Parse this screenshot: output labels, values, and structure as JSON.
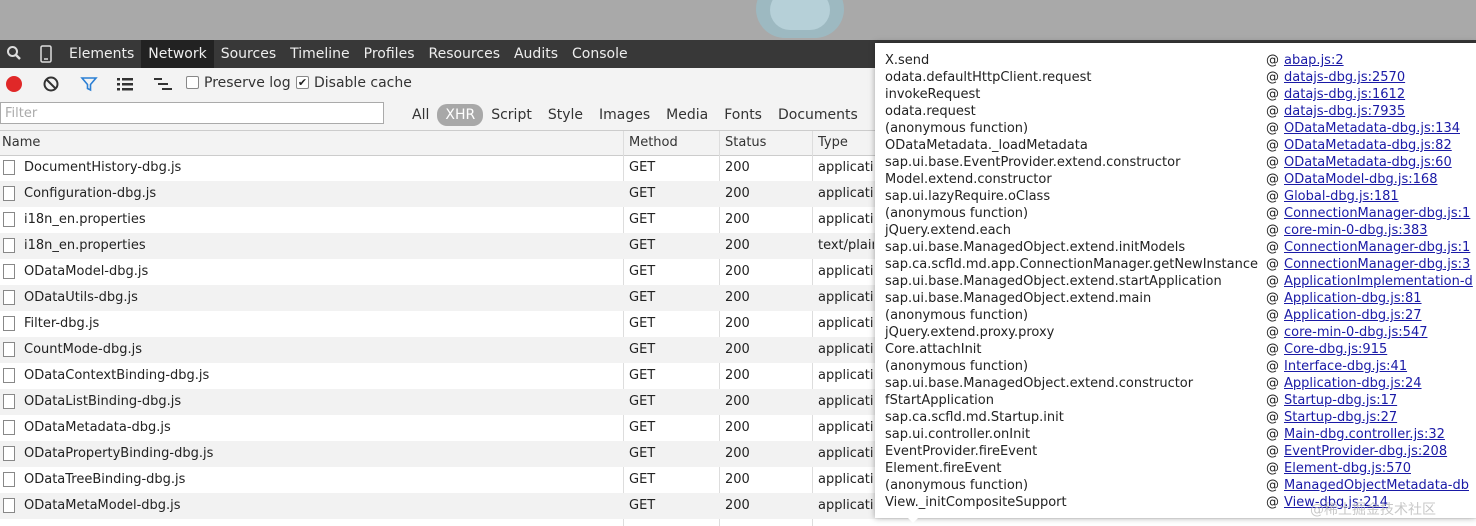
{
  "devtools": {
    "tabs": [
      "Elements",
      "Network",
      "Sources",
      "Timeline",
      "Profiles",
      "Resources",
      "Audits",
      "Console"
    ],
    "active_tab": "Network",
    "icons": {
      "search": "search-icon",
      "device": "mobile-device-icon"
    }
  },
  "toolbar": {
    "record_color": "#e02828",
    "preserve_log": "Preserve log",
    "preserve_log_checked": false,
    "disable_cache": "Disable cache",
    "disable_cache_checked": true
  },
  "filter": {
    "placeholder": "Filter",
    "types": [
      "All",
      "XHR",
      "Script",
      "Style",
      "Images",
      "Media",
      "Fonts",
      "Documents"
    ],
    "active_type": "XHR"
  },
  "table": {
    "headers": {
      "name": "Name",
      "method": "Method",
      "status": "Status",
      "type": "Type"
    },
    "rows": [
      {
        "name": "DocumentHistory-dbg.js",
        "method": "GET",
        "status": "200",
        "type": "applicatio"
      },
      {
        "name": "Configuration-dbg.js",
        "method": "GET",
        "status": "200",
        "type": "applicatio"
      },
      {
        "name": "i18n_en.properties",
        "method": "GET",
        "status": "200",
        "type": "applicatio"
      },
      {
        "name": "i18n_en.properties",
        "method": "GET",
        "status": "200",
        "type": "text/plain"
      },
      {
        "name": "ODataModel-dbg.js",
        "method": "GET",
        "status": "200",
        "type": "applicatio"
      },
      {
        "name": "ODataUtils-dbg.js",
        "method": "GET",
        "status": "200",
        "type": "applicatio"
      },
      {
        "name": "Filter-dbg.js",
        "method": "GET",
        "status": "200",
        "type": "applicatio"
      },
      {
        "name": "CountMode-dbg.js",
        "method": "GET",
        "status": "200",
        "type": "applicatio"
      },
      {
        "name": "ODataContextBinding-dbg.js",
        "method": "GET",
        "status": "200",
        "type": "applicatio"
      },
      {
        "name": "ODataListBinding-dbg.js",
        "method": "GET",
        "status": "200",
        "type": "applicatio"
      },
      {
        "name": "ODataMetadata-dbg.js",
        "method": "GET",
        "status": "200",
        "type": "applicatio"
      },
      {
        "name": "ODataPropertyBinding-dbg.js",
        "method": "GET",
        "status": "200",
        "type": "applicatio"
      },
      {
        "name": "ODataTreeBinding-dbg.js",
        "method": "GET",
        "status": "200",
        "type": "applicatio"
      },
      {
        "name": "ODataMetaModel-dbg.js",
        "method": "GET",
        "status": "200",
        "type": "applicatio"
      }
    ]
  },
  "callstack": {
    "at_symbol": "@",
    "frames": [
      {
        "fn": "X.send",
        "link": "abap.js:2"
      },
      {
        "fn": "odata.defaultHttpClient.request",
        "link": "datajs-dbg.js:2570"
      },
      {
        "fn": "invokeRequest",
        "link": "datajs-dbg.js:1612"
      },
      {
        "fn": "odata.request",
        "link": "datajs-dbg.js:7935"
      },
      {
        "fn": "(anonymous function)",
        "link": "ODataMetadata-dbg.js:134"
      },
      {
        "fn": "ODataMetadata._loadMetadata",
        "link": "ODataMetadata-dbg.js:82"
      },
      {
        "fn": "sap.ui.base.EventProvider.extend.constructor",
        "link": "ODataMetadata-dbg.js:60"
      },
      {
        "fn": "Model.extend.constructor",
        "link": "ODataModel-dbg.js:168"
      },
      {
        "fn": "sap.ui.lazyRequire.oClass",
        "link": "Global-dbg.js:181"
      },
      {
        "fn": "(anonymous function)",
        "link": "ConnectionManager-dbg.js:1"
      },
      {
        "fn": "jQuery.extend.each",
        "link": "core-min-0-dbg.js:383"
      },
      {
        "fn": "sap.ui.base.ManagedObject.extend.initModels",
        "link": "ConnectionManager-dbg.js:1"
      },
      {
        "fn": "sap.ca.scfld.md.app.ConnectionManager.getNewInstance",
        "link": "ConnectionManager-dbg.js:3"
      },
      {
        "fn": "sap.ui.base.ManagedObject.extend.startApplication",
        "link": "ApplicationImplementation-d"
      },
      {
        "fn": "sap.ui.base.ManagedObject.extend.main",
        "link": "Application-dbg.js:81"
      },
      {
        "fn": "(anonymous function)",
        "link": "Application-dbg.js:27"
      },
      {
        "fn": "jQuery.extend.proxy.proxy",
        "link": "core-min-0-dbg.js:547"
      },
      {
        "fn": "Core.attachInit",
        "link": "Core-dbg.js:915"
      },
      {
        "fn": "(anonymous function)",
        "link": "Interface-dbg.js:41"
      },
      {
        "fn": "sap.ui.base.ManagedObject.extend.constructor",
        "link": "Application-dbg.js:24"
      },
      {
        "fn": "fStartApplication",
        "link": "Startup-dbg.js:17"
      },
      {
        "fn": "sap.ca.scfld.md.Startup.init",
        "link": "Startup-dbg.js:27"
      },
      {
        "fn": "sap.ui.controller.onInit",
        "link": "Main-dbg.controller.js:32"
      },
      {
        "fn": "EventProvider.fireEvent",
        "link": "EventProvider-dbg.js:208"
      },
      {
        "fn": "Element.fireEvent",
        "link": "Element-dbg.js:570"
      },
      {
        "fn": "(anonymous function)",
        "link": "ManagedObjectMetadata-db"
      },
      {
        "fn": "View._initCompositeSupport",
        "link": "View-dbg.js:214"
      }
    ]
  },
  "watermark": "@稀土掘金技术社区",
  "colors": {
    "link": "#1a1aa6",
    "tabbar_bg": "#383838",
    "active_filter": "#a8a8a8"
  }
}
